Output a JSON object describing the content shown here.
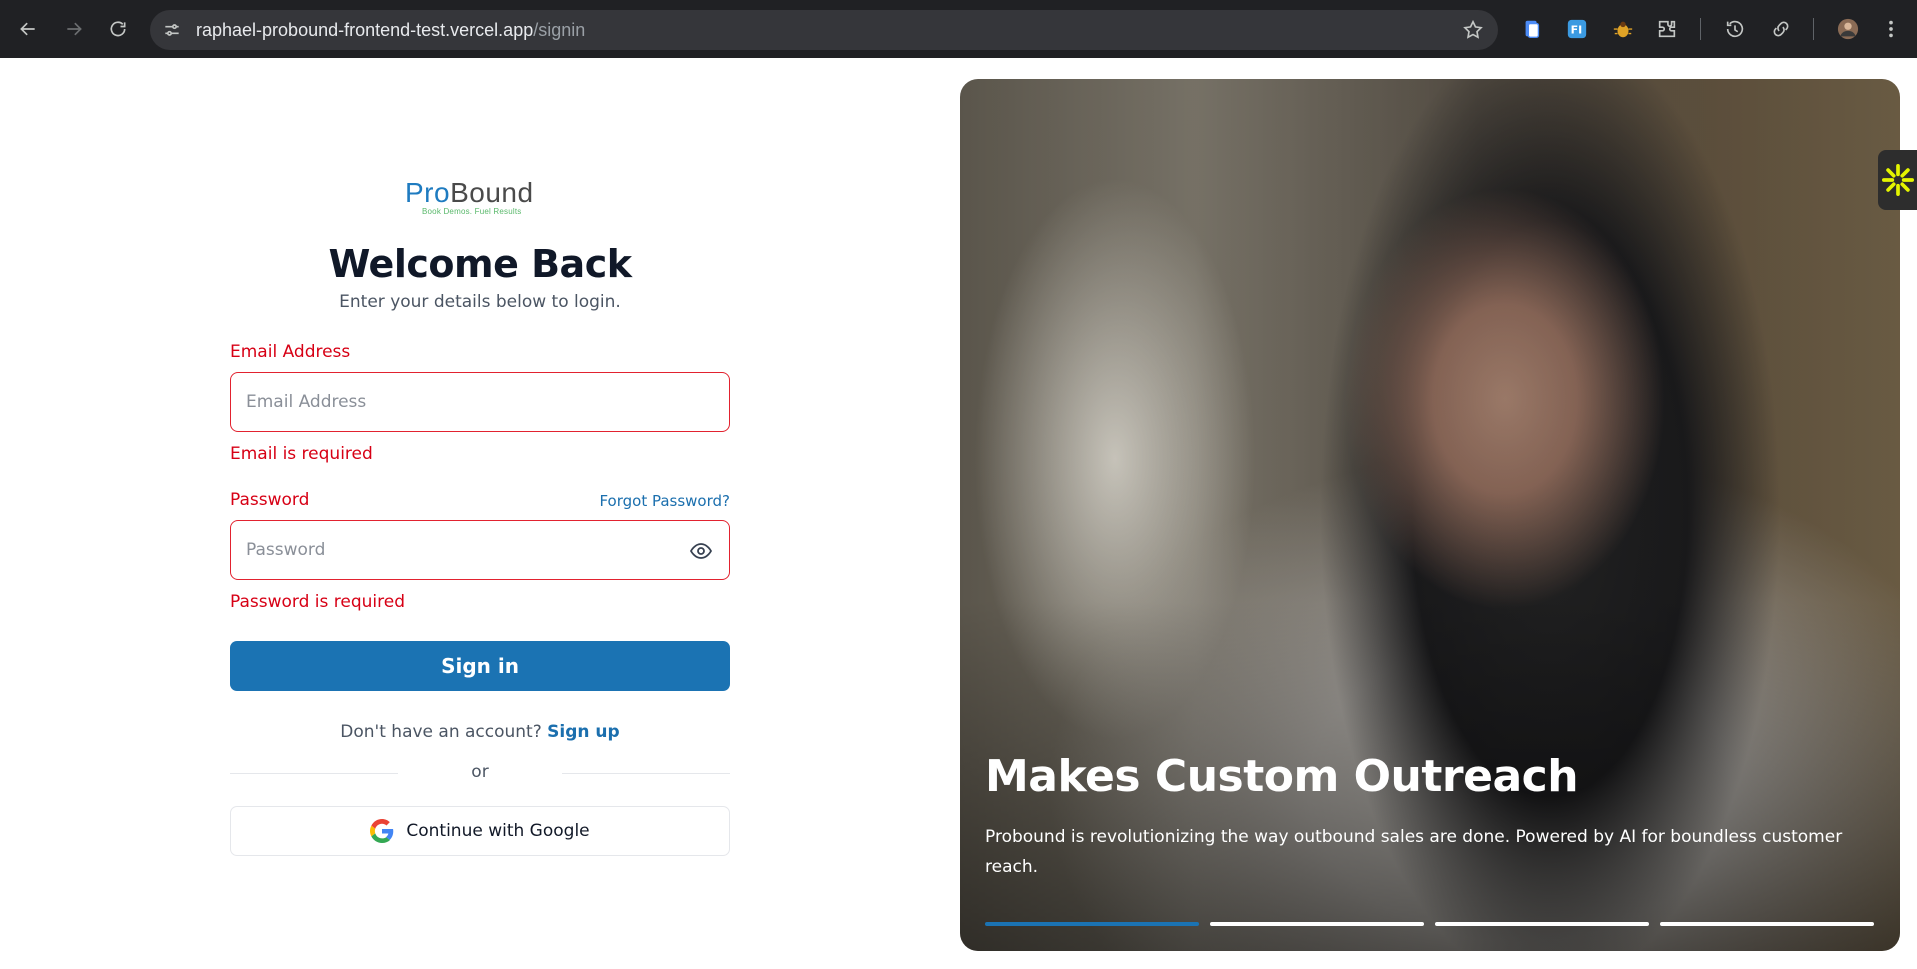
{
  "browser": {
    "url_host": "raphael-probound-frontend-test.vercel.app",
    "url_path": "/signin"
  },
  "logo": {
    "pro": "Pro",
    "bound": "Bound",
    "tagline": "Book Demos. Fuel Results"
  },
  "login": {
    "title": "Welcome Back",
    "subtitle": "Enter your details below to login.",
    "email_label": "Email Address",
    "email_placeholder": "Email Address",
    "email_value": "",
    "email_error": "Email is required",
    "password_label": "Password",
    "password_placeholder": "Password",
    "password_value": "",
    "password_error": "Password is required",
    "forgot_password": "Forgot Password?",
    "signin_label": "Sign in",
    "signup_prompt": "Don't have an account?",
    "signup_link": "Sign up",
    "divider_text": "or",
    "google_label": "Continue with Google"
  },
  "hero": {
    "title": "Makes Custom Outreach",
    "description": "Probound is revolutionizing the way outbound sales are done. Powered by AI for boundless customer reach.",
    "slides_total": 4,
    "active_slide": 1
  },
  "colors": {
    "brand_blue": "#1b73b3",
    "error_red": "#d70015",
    "chrome_bg": "#202124"
  }
}
